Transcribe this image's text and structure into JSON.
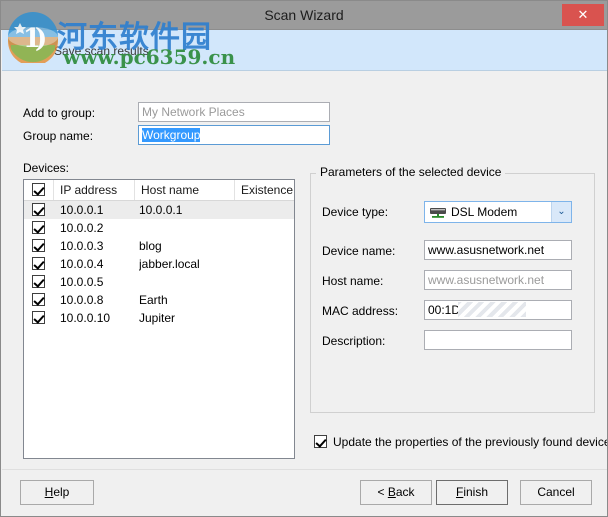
{
  "window": {
    "title": "Scan Wizard",
    "close_icon": "close-icon",
    "close_label": "✕"
  },
  "header": {
    "subtitle": "Save scan results"
  },
  "watermark": {
    "chinese_text": "河东软件园",
    "url": "www.pc6359.cn"
  },
  "form": {
    "add_to_group": {
      "label": "Add to group:",
      "value": "My Network Places",
      "readonly": true
    },
    "group_name": {
      "label": "Group name:",
      "value": "Workgroup",
      "selected": true
    },
    "devices_label": "Devices:"
  },
  "device_list": {
    "columns": [
      "IP address",
      "Host name",
      "Existence"
    ],
    "header_checkbox_checked": true,
    "rows": [
      {
        "checked": true,
        "ip": "10.0.0.1",
        "host": "10.0.0.1",
        "existence": "",
        "selected": true
      },
      {
        "checked": true,
        "ip": "10.0.0.2",
        "host": "",
        "existence": "",
        "selected": false
      },
      {
        "checked": true,
        "ip": "10.0.0.3",
        "host": "blog",
        "existence": "",
        "selected": false
      },
      {
        "checked": true,
        "ip": "10.0.0.4",
        "host": "jabber.local",
        "existence": "",
        "selected": false
      },
      {
        "checked": true,
        "ip": "10.0.0.5",
        "host": "",
        "existence": "",
        "selected": false
      },
      {
        "checked": true,
        "ip": "10.0.0.8",
        "host": "Earth",
        "existence": "",
        "selected": false
      },
      {
        "checked": true,
        "ip": "10.0.0.10",
        "host": "Jupiter",
        "existence": "",
        "selected": false
      }
    ]
  },
  "parameters": {
    "legend": "Parameters of the selected device",
    "device_type": {
      "label": "Device type:",
      "value": "DSL Modem",
      "icon": "modem-icon",
      "arrow": "⌄"
    },
    "device_name": {
      "label": "Device name:",
      "value": "www.asusnetwork.net",
      "readonly": false
    },
    "host_name": {
      "label": "Host name:",
      "value": "www.asusnetwork.net",
      "readonly": true
    },
    "mac_address": {
      "label": "MAC address:",
      "value": "00:1D",
      "masked": true
    },
    "description": {
      "label": "Description:",
      "value": ""
    }
  },
  "update_option": {
    "label": "Update the properties of the previously found devices",
    "checked": true
  },
  "footer": {
    "help": "Help",
    "help_pre": "H",
    "help_post": "elp",
    "back_pre": "< ",
    "back_mid": "B",
    "back_post": "ack",
    "finish_pre": "F",
    "finish_post": "inish",
    "cancel": "Cancel"
  },
  "colors": {
    "titlebar": "#9b9b9b",
    "banner": "#d2e7fb",
    "close": "#d9534f",
    "selection": "#3399ff",
    "watermark_blue": "#2f7fcf",
    "watermark_green": "#2e8b3d"
  }
}
